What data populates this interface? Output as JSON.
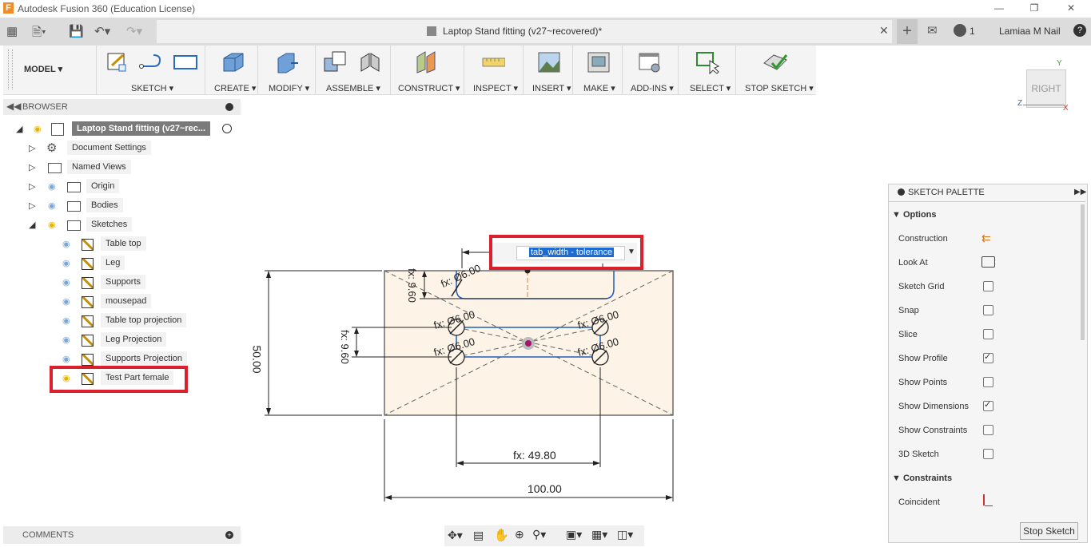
{
  "app": {
    "title": "Autodesk Fusion 360 (Education License)"
  },
  "document": {
    "tab_title": "Laptop Stand fitting (v27~recovered)*",
    "jobs_count": "1",
    "user": "Lamiaa M Nail"
  },
  "workspace": {
    "label": "MODEL"
  },
  "toolbar_groups": {
    "sketch": "SKETCH",
    "create": "CREATE",
    "modify": "MODIFY",
    "assemble": "ASSEMBLE",
    "construct": "CONSTRUCT",
    "inspect": "INSPECT",
    "insert": "INSERT",
    "make": "MAKE",
    "addins": "ADD-INS",
    "select": "SELECT",
    "stop_sketch": "STOP SKETCH"
  },
  "browser": {
    "title": "BROWSER",
    "root": "Laptop Stand fitting (v27~rec...",
    "items": {
      "document_settings": "Document Settings",
      "named_views": "Named Views",
      "origin": "Origin",
      "bodies": "Bodies",
      "sketches": "Sketches",
      "s1": "Table top",
      "s2": "Leg",
      "s3": "Supports",
      "s4": "mousepad",
      "s5": "Table top projection",
      "s6": "Leg Projection",
      "s7": "Supports Projection",
      "s8": "Test Part female"
    }
  },
  "comments": {
    "title": "COMMENTS"
  },
  "viewcube": {
    "face": "RIGHT",
    "axis_y": "Y",
    "axis_z": "Z",
    "axis_x": "X"
  },
  "canvas": {
    "dim_input_value": "tab_width - tolerance",
    "dim_height": "50.00",
    "dim_width": "100.00",
    "dim_inner_width": "fx: 49.80",
    "dim_v1": "fx: 9.60",
    "dim_v2": "fx: 9.60",
    "dia_top": "fx: Ø6.00",
    "dia_ml": "fx: Ø6.00",
    "dia_mr": "fx: Ø6.00",
    "dia_ll": "fx: Ø6.00",
    "dia_lr": "fx: Ø6.00"
  },
  "palette": {
    "title": "SKETCH PALETTE",
    "options_title": "Options",
    "options": {
      "construction": "Construction",
      "look_at": "Look At",
      "sketch_grid": "Sketch Grid",
      "snap": "Snap",
      "slice": "Slice",
      "show_profile": "Show Profile",
      "show_points": "Show Points",
      "show_dimensions": "Show Dimensions",
      "show_constraints": "Show Constraints",
      "sketch_3d": "3D Sketch"
    },
    "checked": {
      "sketch_grid": false,
      "snap": false,
      "slice": false,
      "show_profile": true,
      "show_points": false,
      "show_dimensions": true,
      "show_constraints": false,
      "sketch_3d": false
    },
    "constraints_title": "Constraints",
    "coincident": "Coincident",
    "stop_button": "Stop Sketch"
  },
  "colors": {
    "highlight": "#d9202c",
    "sketch_line": "#1f5fbf",
    "sketch_fill": "#fdf3e7"
  }
}
